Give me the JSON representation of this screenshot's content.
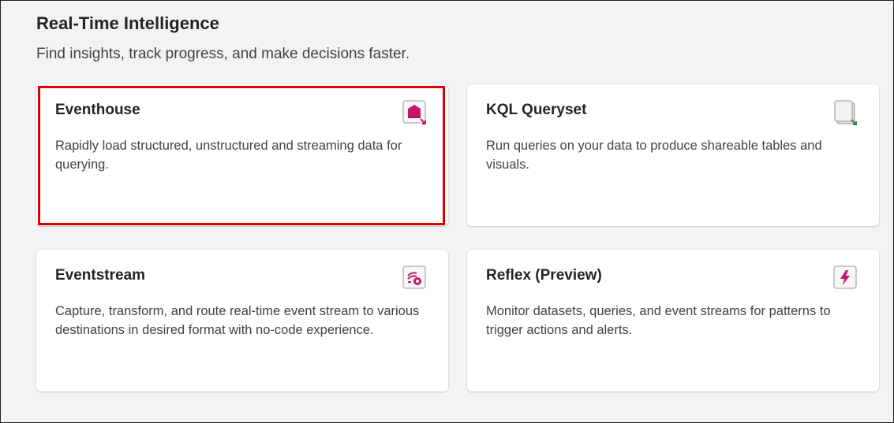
{
  "section": {
    "title": "Real-Time Intelligence",
    "subtitle": "Find insights, track progress, and make decisions faster."
  },
  "cards": [
    {
      "title": "Eventhouse",
      "description": "Rapidly load structured, unstructured and streaming data for querying.",
      "icon": "eventhouse-icon",
      "highlighted": true
    },
    {
      "title": "KQL Queryset",
      "description": "Run queries on your data to produce shareable tables and visuals.",
      "icon": "kql-queryset-icon",
      "highlighted": false
    },
    {
      "title": "Eventstream",
      "description": "Capture, transform, and route real-time event stream to various destinations in desired format with no-code experience.",
      "icon": "eventstream-icon",
      "highlighted": false
    },
    {
      "title": "Reflex (Preview)",
      "description": "Monitor datasets, queries, and event streams for patterns to trigger actions and alerts.",
      "icon": "reflex-icon",
      "highlighted": false
    }
  ],
  "colors": {
    "accent_pink": "#c4156a",
    "queryset_green": "#2e8b3e",
    "highlight_red": "#e00000",
    "page_background": "#f3f3f3"
  }
}
